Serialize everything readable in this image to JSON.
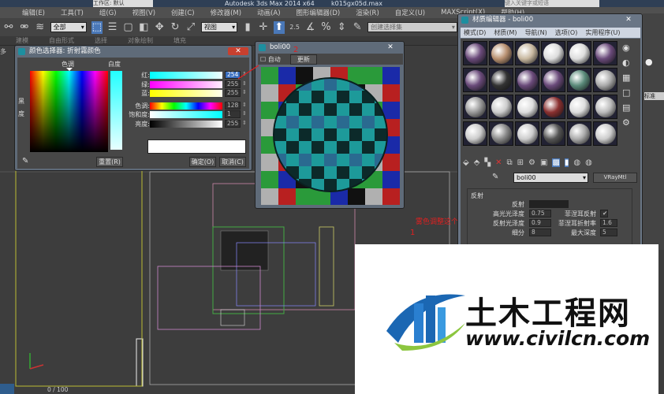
{
  "title_bar": {
    "app": "Autodesk 3ds Max 2014 x64",
    "file": "k015gx05d.max",
    "workspace": "工作区: 默认",
    "search_placeholder": "键入关键字或短语"
  },
  "menu": [
    "编辑(E)",
    "工具(T)",
    "组(G)",
    "视图(V)",
    "创建(C)",
    "修改器(M)",
    "动画(A)",
    "图形编辑器(D)",
    "渲染(R)",
    "自定义(U)",
    "MAXScript(X)",
    "帮助(H)"
  ],
  "toolbar": {
    "filter": "全部",
    "ref_coord": "视图",
    "selection_set": "创建选择集",
    "snap_angle": "2.5"
  },
  "ribbon_tabs": [
    "建模",
    "自由形式",
    "选择",
    "对象绘制",
    "填充"
  ],
  "viewport": {
    "label": "多",
    "frame": "0 / 100"
  },
  "color_picker": {
    "title": "颜色选择器: 折射霧颜色",
    "hue_label": "色调",
    "white_label": "白度",
    "black_label": "黑度",
    "rows": [
      {
        "label": "红:",
        "value": "254"
      },
      {
        "label": "绿:",
        "value": "255"
      },
      {
        "label": "蓝:",
        "value": "255"
      },
      {
        "label": "色调:",
        "value": "128"
      },
      {
        "label": "饱和度:",
        "value": "1"
      },
      {
        "label": "亮度:",
        "value": "255"
      }
    ],
    "reset": "重置(R)",
    "ok": "确定(O)",
    "cancel": "取消(C)",
    "current_color": "#ffffff"
  },
  "render_window": {
    "title": "boli00",
    "auto": "自动",
    "update": "更新"
  },
  "annotations": {
    "arrow_1": "1",
    "arrow_2": "2",
    "note": "雾色调整这个",
    "color": "#e02020"
  },
  "material_editor": {
    "title": "材质编辑器 - boli00",
    "menu": [
      "模式(D)",
      "材质(M)",
      "导航(N)",
      "选项(O)",
      "实用程序(U)"
    ],
    "material_name": "boli00",
    "material_type": "VRayMtl",
    "section": "反射",
    "params": [
      {
        "label": "反射",
        "value": ""
      },
      {
        "label": "高光光泽度",
        "value": "0.75",
        "right_label": "菲涅耳反射",
        "right_value": "✔"
      },
      {
        "label": "反射光泽度",
        "value": "0.9",
        "right_label": "菲涅耳折射率",
        "right_value": "1.6"
      },
      {
        "label": "细分",
        "value": "8",
        "right_label": "最大深度",
        "right_value": "5"
      }
    ]
  },
  "command_panel": {
    "label": "标准"
  },
  "watermark": {
    "name": "土木工程网",
    "url": "www.civilcn.com"
  }
}
